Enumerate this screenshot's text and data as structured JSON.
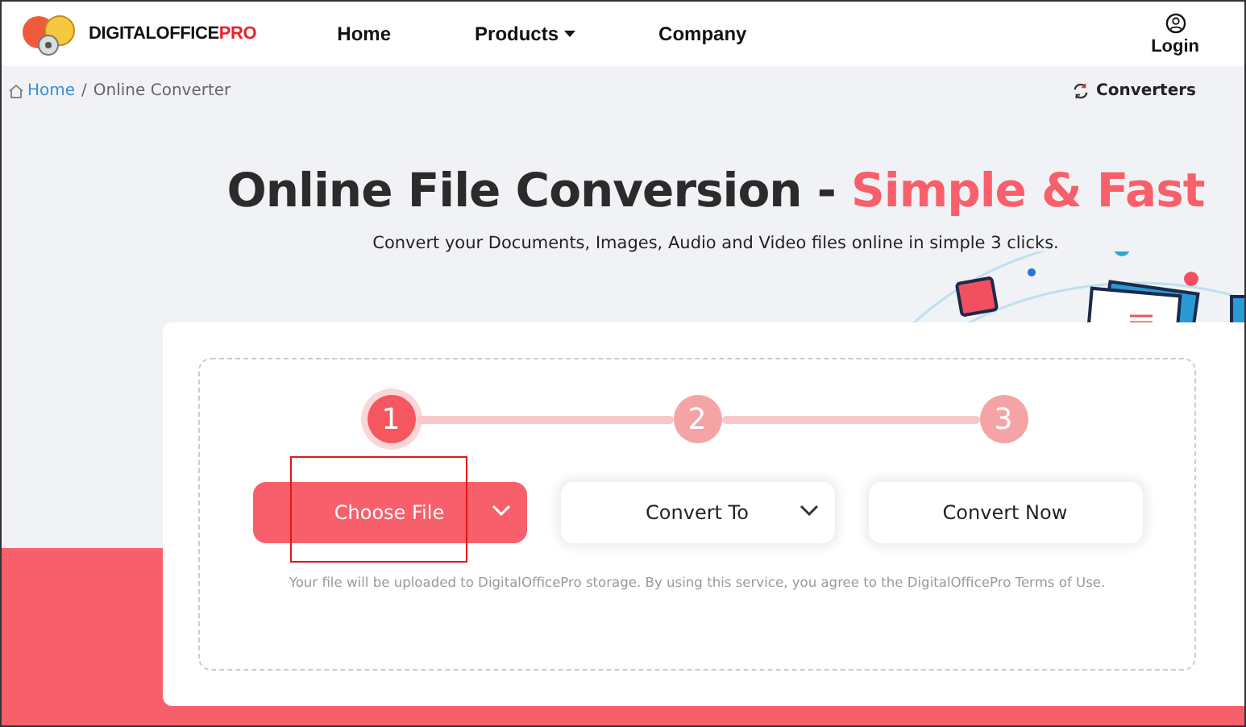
{
  "brand": {
    "name": "DIGITALOFFICE",
    "accent": "PRO"
  },
  "nav": [
    {
      "label": "Home",
      "dropdown": false
    },
    {
      "label": "Products",
      "dropdown": true
    },
    {
      "label": "Company",
      "dropdown": false
    }
  ],
  "login": "Login",
  "breadcrumb": [
    "Home",
    "/",
    "Online Converter"
  ],
  "converters": "Converters",
  "hero": {
    "title": "Online File Conversion - ",
    "accent": "Simple & Fast",
    "subtitle": "Convert your Documents, Images, Audio and Video files online in simple 3 clicks."
  },
  "steps": [
    {
      "label": "1",
      "selected": true
    },
    {
      "label": "2",
      "selected": false
    },
    {
      "label": "3",
      "selected": false
    }
  ],
  "actions": [
    {
      "label": "Choose File",
      "kind": "primary",
      "dropdown": true,
      "highlighted": true
    },
    {
      "label": "Convert To",
      "kind": "select",
      "dropdown": true,
      "highlighted": false
    },
    {
      "label": "Convert Now",
      "kind": "plain",
      "dropdown": false,
      "highlighted": false
    }
  ],
  "note": "Your file will be uploaded to DigitalOfficePro storage.  By using this service, you agree to the DigitalOfficePro Terms of Use."
}
